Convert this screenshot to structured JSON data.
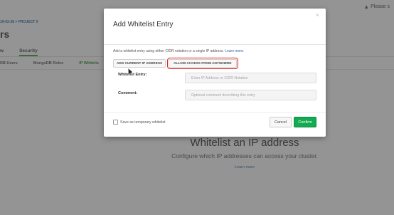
{
  "background": {
    "pause_label": "Please s",
    "breadcrumb": "19-02-28 > PROJECT 0",
    "title": "rs",
    "tabs": [
      {
        "label": "w"
      },
      {
        "label": "Security"
      }
    ],
    "subtabs": [
      {
        "label": "DB Users"
      },
      {
        "label": "MongoDB Roles"
      },
      {
        "label": "IP Whitelis"
      }
    ],
    "empty_state": {
      "heading": "Whitelist an IP address",
      "subheading": "Configure which IP addresses can access your cluster.",
      "link": "Learn more"
    }
  },
  "modal": {
    "title": "Add Whitelist Entry",
    "close_glyph": "×",
    "description": "Add a whitelist entry using either CIDR notation or a single IP address.",
    "learn_more": "Learn more.",
    "buttons": {
      "add_current_ip": "ADD CURRENT IP ADDRESS",
      "allow_anywhere": "ALLOW ACCESS FROM ANYWHERE"
    },
    "fields": {
      "whitelist_entry": {
        "label": "Whitelist Entry:",
        "value": "",
        "placeholder": "Enter IP Address or CIDR Notation"
      },
      "comment": {
        "label": "Comment:",
        "value": "",
        "placeholder": "Optional comment describing this entry"
      }
    },
    "temporary": {
      "label": "Save as temporary whitelist",
      "checked": false
    },
    "cancel_label": "Cancel",
    "confirm_label": "Confirm"
  },
  "colors": {
    "confirm_green": "#13aa52",
    "highlight_red": "#e02424",
    "link_blue": "#2d5f9e"
  }
}
